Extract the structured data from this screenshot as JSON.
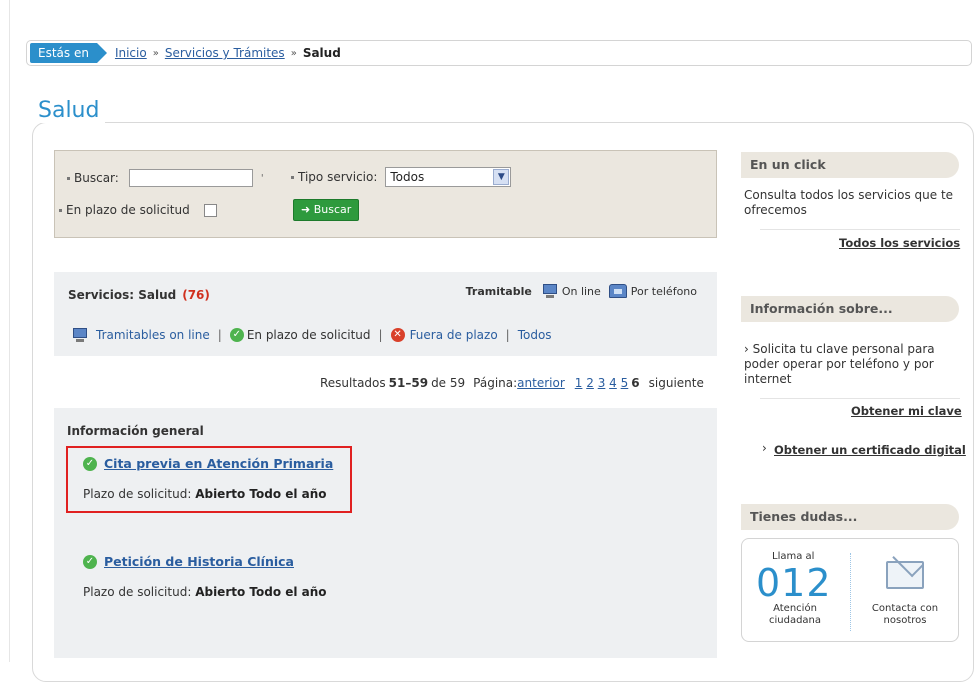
{
  "breadcrumb": {
    "prefix": "Estás en",
    "items": [
      "Inicio",
      "Servicios y Trámites"
    ],
    "current": "Salud",
    "separator": "»"
  },
  "page_title": "Salud",
  "search": {
    "buscar_label": "Buscar:",
    "buscar_value": "",
    "tipo_label": "Tipo servicio:",
    "tipo_selected": "Todos",
    "plazo_label": "En plazo de solicitud",
    "plazo_checked": false,
    "button_label": "Buscar"
  },
  "services": {
    "title": "Servicios: Salud",
    "count": "(76)",
    "tramitable_label": "Tramitable",
    "online_label": "On line",
    "telefono_label": "Por teléfono",
    "filters": {
      "online": "Tramitables on line",
      "en_plazo": "En plazo de solicitud",
      "fuera": "Fuera de plazo",
      "todos": "Todos"
    }
  },
  "results": {
    "prefix": "Resultados",
    "range": "51–59",
    "of": "de 59",
    "page_label": "Página:",
    "prev": "anterior",
    "pages": [
      "1",
      "2",
      "3",
      "4",
      "5"
    ],
    "current_page": "6",
    "next": "siguiente"
  },
  "info": {
    "title": "Información general",
    "items": [
      {
        "link": "Cita previa en Atención Primaria",
        "plazo_label": "Plazo de solicitud:",
        "plazo_value": "Abierto Todo el año"
      },
      {
        "link": "Petición de Historia Clínica",
        "plazo_label": "Plazo de solicitud:",
        "plazo_value": "Abierto Todo el año"
      }
    ]
  },
  "sidebar": {
    "click_title": "En un click",
    "click_text": "Consulta todos los servicios que te ofrecemos",
    "click_link": "Todos los servicios",
    "info_title": "Información sobre...",
    "info_text": "Solicita tu clave personal para poder operar por teléfono y por internet",
    "info_link": "Obtener mi clave",
    "cert_link": "Obtener un certificado digital",
    "dudas_title": "Tienes dudas...",
    "llama": "Llama al",
    "number": "012",
    "atencion": "Atención ciudadana",
    "contacta": "Contacta con nosotros"
  },
  "colors": {
    "accent": "#2b8fcb",
    "button": "#2e9a3d",
    "count": "#d0301e",
    "highlight": "#e02020"
  }
}
